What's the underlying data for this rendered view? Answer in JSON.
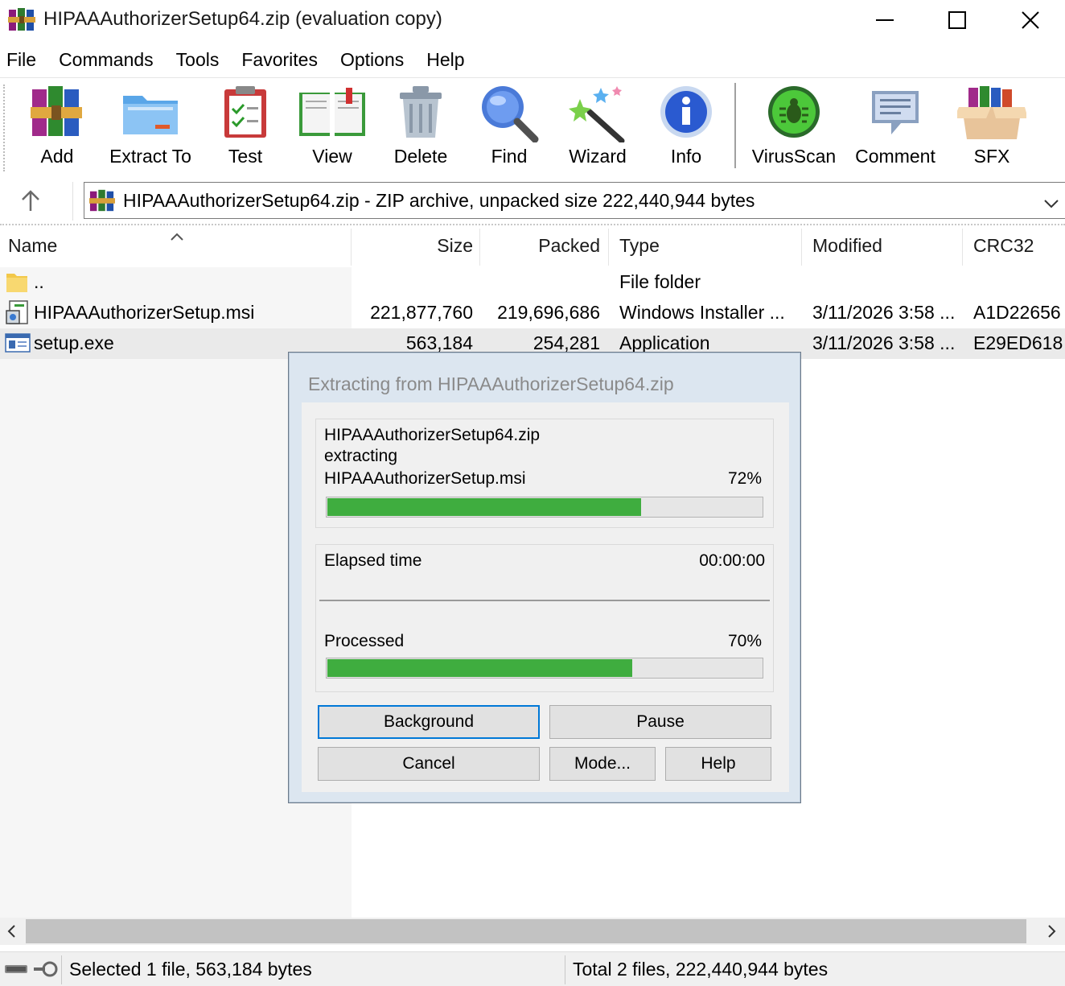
{
  "window": {
    "title": "HIPAAAuthorizerSetup64.zip (evaluation copy)",
    "controls": [
      "minimize",
      "maximize",
      "close"
    ]
  },
  "menu": [
    "File",
    "Commands",
    "Tools",
    "Favorites",
    "Options",
    "Help"
  ],
  "toolbar": {
    "add": "Add",
    "extract_to": "Extract To",
    "test": "Test",
    "view": "View",
    "delete": "Delete",
    "find": "Find",
    "wizard": "Wizard",
    "info": "Info",
    "virusscan": "VirusScan",
    "comment": "Comment",
    "sfx": "SFX"
  },
  "address": {
    "text": "HIPAAAuthorizerSetup64.zip - ZIP archive, unpacked size 222,440,944 bytes"
  },
  "columns": {
    "name": "Name",
    "size": "Size",
    "packed": "Packed",
    "type": "Type",
    "modified": "Modified",
    "crc": "CRC32"
  },
  "files": [
    {
      "name": "..",
      "size": "",
      "packed": "",
      "type": "File folder",
      "modified": "",
      "crc": "",
      "icon": "folder-icon"
    },
    {
      "name": "HIPAAAuthorizerSetup.msi",
      "size": "221,877,760",
      "packed": "219,696,686",
      "type": "Windows Installer ...",
      "modified": "3/11/2026 3:58 ...",
      "crc": "A1D22656",
      "icon": "msi-icon"
    },
    {
      "name": "setup.exe",
      "size": "563,184",
      "packed": "254,281",
      "type": "Application",
      "modified": "3/11/2026 3:58 ...",
      "crc": "E29ED618",
      "icon": "exe-icon",
      "selected": true
    }
  ],
  "status": {
    "left": "Selected 1 file, 563,184 bytes",
    "right": "Total 2 files, 222,440,944 bytes"
  },
  "dialog": {
    "title": "Extracting from HIPAAAuthorizerSetup64.zip",
    "archive": "HIPAAAuthorizerSetup64.zip",
    "action": "extracting",
    "current_file": "HIPAAAuthorizerSetup.msi",
    "file_percent": "72%",
    "file_progress": 0.72,
    "elapsed_label": "Elapsed time",
    "elapsed_value": "00:00:00",
    "processed_label": "Processed",
    "processed_percent": "70%",
    "processed_progress": 0.7,
    "buttons": {
      "background": "Background",
      "pause": "Pause",
      "cancel": "Cancel",
      "mode": "Mode...",
      "help": "Help"
    }
  },
  "colors": {
    "progress_fill": "#3fad3f",
    "dialog_frame": "#dce6f0",
    "focus_border": "#0078d7"
  }
}
